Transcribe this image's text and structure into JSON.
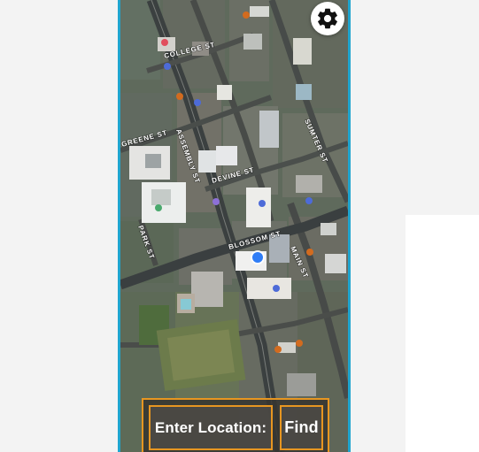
{
  "map": {
    "street_labels": {
      "college": "COLLEGE ST",
      "greene": "GREENE ST",
      "assembly": "ASSEMBLY ST",
      "sumter": "SUMTER ST",
      "devine": "DEVINE ST",
      "blossom": "BLOSSOM ST",
      "park": "PARK ST",
      "main": "MAIN ST"
    }
  },
  "controls": {
    "settings_icon": "gear-icon",
    "enter_location_label": "Enter Location:",
    "find_label": "Find"
  },
  "colors": {
    "phone_border": "#1fa5cf",
    "button_border": "#e79621",
    "button_text": "#ffffff",
    "location_dot": "#2f7df6"
  }
}
